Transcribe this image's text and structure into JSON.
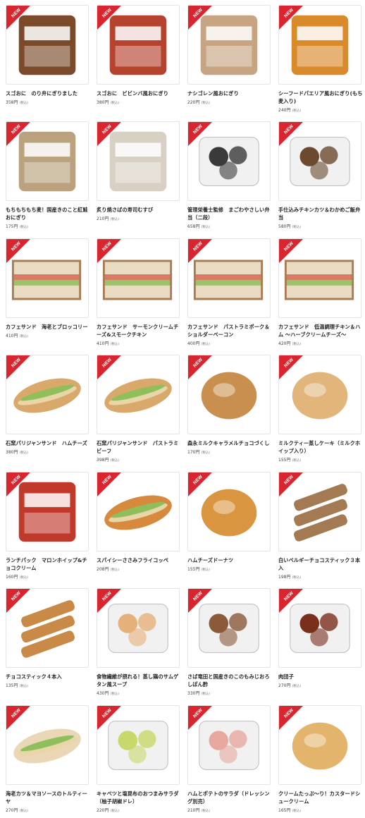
{
  "badge_label": "NEW",
  "products": [
    {
      "name": "スゴおに　のり弁にぎりました",
      "price": "358円",
      "tax": "(税込)",
      "image": "noriben-onigiri-package",
      "color": "#7a4a2a"
    },
    {
      "name": "スゴおに　ビビンバ風おにぎり",
      "price": "380円",
      "tax": "(税込)",
      "image": "bibimbap-onigiri-package",
      "color": "#b5432e"
    },
    {
      "name": "ナシゴレン風おにぎり",
      "price": "220円",
      "tax": "(税込)",
      "image": "nasi-goreng-onigiri-package",
      "color": "#c7a583"
    },
    {
      "name": "シーフードパエリア風おにぎり(もち麦入り)",
      "price": "240円",
      "tax": "(税込)",
      "image": "seafood-paella-onigiri-package",
      "color": "#d98a2b"
    },
    {
      "name": "もちもちもち麦！国産きのこと紅鮭おにぎり",
      "price": "175円",
      "tax": "(税込)",
      "image": "mushroom-salmon-onigiri-package",
      "color": "#b9a27d"
    },
    {
      "name": "炙り焼さばの寿司むすび",
      "price": "210円",
      "tax": "(税込)",
      "image": "grilled-mackerel-sushi-package",
      "color": "#d7d0c3"
    },
    {
      "name": "管理栄養士監修　まごわやさしい弁当（二段）",
      "price": "658円",
      "tax": "(税込)",
      "image": "two-tier-bento",
      "color": "#3a3a3a"
    },
    {
      "name": "手仕込みチキンカツ＆わかめご飯弁当",
      "price": "580円",
      "tax": "(税込)",
      "image": "chicken-katsu-bento",
      "color": "#6b4a2f"
    },
    {
      "name": "カフェサンド　海老とブロッコリー",
      "price": "410円",
      "tax": "(税込)",
      "image": "shrimp-broccoli-sandwich",
      "color": "#b89776"
    },
    {
      "name": "カフェサンド　サーモンクリームチーズ&スモークチキン",
      "price": "410円",
      "tax": "(税込)",
      "image": "salmon-chicken-sandwich",
      "color": "#b89776"
    },
    {
      "name": "カフェサンド　パストラミポーク＆ショルダーベーコン",
      "price": "400円",
      "tax": "(税込)",
      "image": "pastrami-bacon-sandwich",
      "color": "#b89776"
    },
    {
      "name": "カフェサンド　低温調理チキン＆ハム ～ハーブクリームチーズ～",
      "price": "420円",
      "tax": "(税込)",
      "image": "chicken-ham-sandwich",
      "color": "#b89776"
    },
    {
      "name": "石窯パリジャンサンド　ハムチーズ",
      "price": "380円",
      "tax": "(税込)",
      "image": "ham-cheese-baguette",
      "color": "#d9a86b"
    },
    {
      "name": "石窯パリジャンサンド　パストラミビーフ",
      "price": "398円",
      "tax": "(税込)",
      "image": "pastrami-beef-baguette",
      "color": "#d9a86b"
    },
    {
      "name": "森永ミルクキャラメルチョコづくし",
      "price": "170円",
      "tax": "(税込)",
      "image": "caramel-choco-bun",
      "color": "#c98f4e"
    },
    {
      "name": "ミルクティー蒸しケーキ（ミルクホイップ入り）",
      "price": "155円",
      "tax": "(税込)",
      "image": "milk-tea-steamed-cake",
      "color": "#e2b57a"
    },
    {
      "name": "ランチパック　マロンホイップ&チョコクリーム",
      "price": "160円",
      "tax": "(税込)",
      "image": "lunch-pack-package",
      "color": "#c0392b"
    },
    {
      "name": "スパイシーささみフライコッペ",
      "price": "208円",
      "tax": "(税込)",
      "image": "spicy-chicken-koppe",
      "color": "#d7893e"
    },
    {
      "name": "ハムチーズドーナツ",
      "price": "155円",
      "tax": "(税込)",
      "image": "ham-cheese-donut",
      "color": "#d9953f"
    },
    {
      "name": "白いベルギーチョコスティック３本入",
      "price": "198円",
      "tax": "(税込)",
      "image": "white-choco-stick",
      "color": "#a37a52"
    },
    {
      "name": "チョコスティック４本入",
      "price": "135円",
      "tax": "(税込)",
      "image": "choco-stick",
      "color": "#c88a46"
    },
    {
      "name": "食物繊維が摂れる！蒸し鶏のサムゲタン風スープ",
      "price": "430円",
      "tax": "(税込)",
      "image": "samgyetang-soup",
      "color": "#e6b07a"
    },
    {
      "name": "さば竜田と国産きのこのもみじおろしぽん酢",
      "price": "330円",
      "tax": "(税込)",
      "image": "mackerel-ponzu-dish",
      "color": "#8a5a3a"
    },
    {
      "name": "肉団子",
      "price": "270円",
      "tax": "(税込)",
      "image": "meatballs-pack",
      "color": "#7a2e1c"
    },
    {
      "name": "海老カツ＆マヨソースのトルティーヤ",
      "price": "270円",
      "tax": "(税込)",
      "image": "shrimp-tortilla",
      "color": "#e9d7b6"
    },
    {
      "name": "キャベツと塩昆布のおつまみサラダ（柚子胡椒ドレ）",
      "price": "220円",
      "tax": "(税込)",
      "image": "cabbage-kombu-salad",
      "color": "#c9d86a"
    },
    {
      "name": "ハムとポテトのサラダ（ドレッシング別売）",
      "price": "210円",
      "tax": "(税込)",
      "image": "ham-potato-salad",
      "color": "#e8a8a0"
    },
    {
      "name": "クリームたっぷ～り！カスタードシュークリーム",
      "price": "165円",
      "tax": "(税込)",
      "image": "custard-cream-puff",
      "color": "#e3b46b"
    }
  ]
}
